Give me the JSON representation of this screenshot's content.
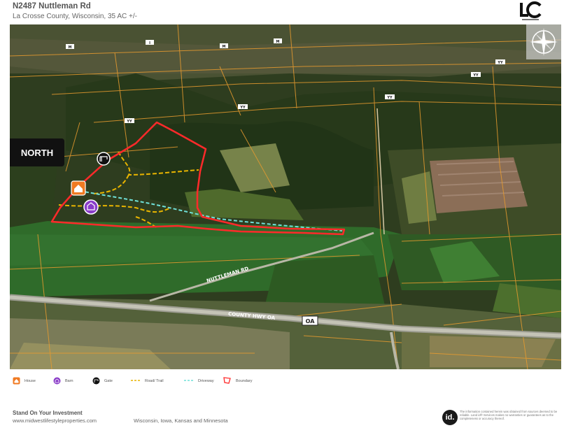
{
  "header": {
    "title": "N2487 Nuttleman Rd",
    "subtitle": "La Crosse County, Wisconsin, 35 AC +/-"
  },
  "map": {
    "north_label": "NORTH",
    "road_labels": {
      "nuttleman": "NUTTLEMAN RD",
      "county_hwy": "COUNTY HWY OA",
      "oa_shield": "OA",
      "yy": "YY",
      "m": "M",
      "i": "I"
    },
    "colors": {
      "boundary": "#ff2a2a",
      "road_trail": "#e8b400",
      "driveway": "#6fe0d8",
      "house": "#f07a22",
      "barn": "#8a3cc8",
      "gate": "#111111"
    }
  },
  "legend": [
    {
      "label": "House",
      "icon": "house-icon"
    },
    {
      "label": "Barn",
      "icon": "barn-icon"
    },
    {
      "label": "Gate",
      "icon": "gate-icon"
    },
    {
      "label": "Road/ Trail",
      "icon": "road-trail-icon"
    },
    {
      "label": "Driveway",
      "icon": "driveway-icon"
    },
    {
      "label": "Boundary",
      "icon": "boundary-icon"
    }
  ],
  "footer": {
    "tagline": "Stand On Your Investment",
    "url": "www.midwestlifestyleproperties.com",
    "states": "Wisconsin, Iowa, Kansas and Minnesota",
    "id_logo": "id.",
    "disclaimer": "The information contained herein was obtained from sources deemed to be reliable. Land id® Services makes no warranties or guarantees as to the completeness or accuracy thereof."
  }
}
